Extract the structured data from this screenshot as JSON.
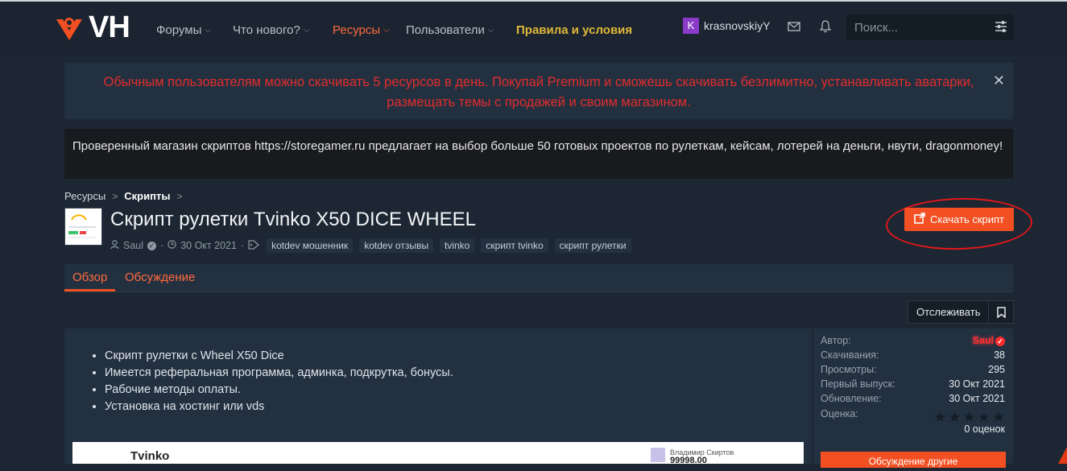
{
  "header": {
    "logo_text": "VH",
    "nav": [
      {
        "label": "Форумы"
      },
      {
        "label": "Что нового?"
      },
      {
        "label": "Ресурсы"
      },
      {
        "label": "Пользователи"
      },
      {
        "label": "Правила и условия"
      }
    ],
    "user": {
      "avatar_letter": "K",
      "name": "krasnovskiyY"
    },
    "search_placeholder": "Поиск..."
  },
  "notices": {
    "premium": "Обычным пользователям можно скачивать 5 ресурсов в день. Покупай Premium и сможешь скачивать безлимитно, устанавливать аватарки, размещать темы с продажей и своим магазином.",
    "ad": "Проверенный магазин скриптов https://storegamer.ru предлагает на выбор больше 50 готовых проектов по рулеткам, кейсам, лотерей на деньги, нвути, dragonmoney!"
  },
  "breadcrumb": [
    "Ресурсы",
    "Скрипты"
  ],
  "resource": {
    "title": "Скрипт рулетки Tvinko X50 DICE WHEEL",
    "author": "Saul",
    "date": "30 Окт 2021",
    "tags": [
      "kotdev мошенник",
      "kotdev отзывы",
      "tvinko",
      "скрипт tvinko",
      "скрипт рулетки"
    ],
    "download_label": "Скачать скрипт"
  },
  "tabs": [
    "Обзор",
    "Обсуждение"
  ],
  "watch_label": "Отслеживать",
  "description": [
    "Скрипт рулетки с Wheel X50 Dice",
    "Имеется реферальная программа, админка, подкрутка, бонусы.",
    "Рабочие методы оплаты.",
    "Установка на хостинг или vds"
  ],
  "preview": {
    "brand": "Tvinko",
    "user_name": "Владимир Скиртов",
    "balance": "99998.00"
  },
  "sidebar": {
    "author_label": "Автор:",
    "author": "Saul",
    "downloads_label": "Скачивания:",
    "downloads": "38",
    "views_label": "Просмотры:",
    "views": "295",
    "first_release_label": "Первый выпуск:",
    "first_release": "30 Окт 2021",
    "updated_label": "Обновление:",
    "updated": "30 Окт 2021",
    "rating_label": "Оценка:",
    "rating_value": 0,
    "rating_count": "0 оценок",
    "more_button": "Обсуждение другие"
  },
  "colors": {
    "accent": "#f25022",
    "rules": "#e0b83a",
    "alert": "#e02d2d",
    "bg": "#1c2733"
  }
}
